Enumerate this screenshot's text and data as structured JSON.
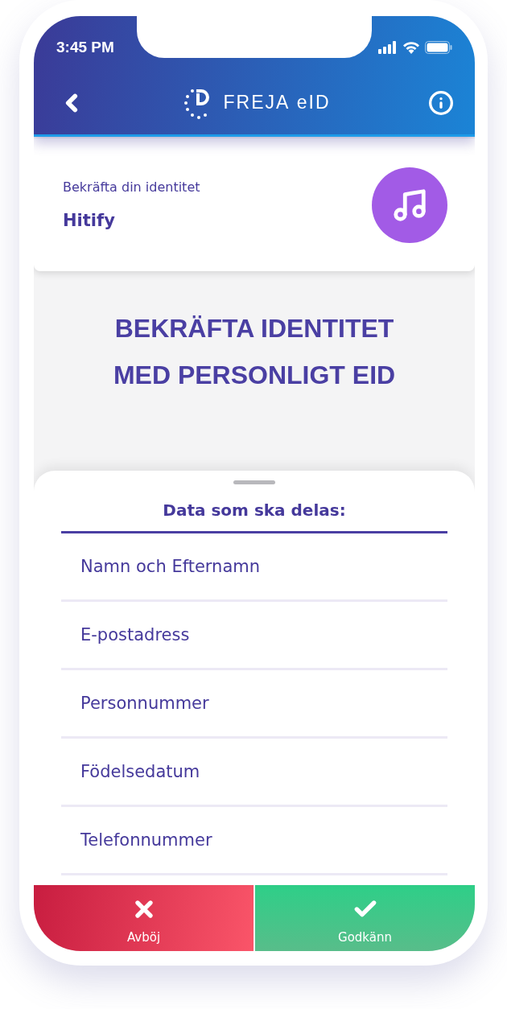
{
  "status_bar": {
    "time": "3:45 PM"
  },
  "header": {
    "brand": "**FREJA** eID"
  },
  "request_card": {
    "caption": "Bekräfta din identitet",
    "service": "Hitify"
  },
  "heading": "BEKRÄFTA IDENTITET MED PERSONLIGT EID",
  "sheet": {
    "title": "Data som ska delas:",
    "items": [
      {
        "label": "Namn och Efternamn"
      },
      {
        "label": "E-postadress"
      },
      {
        "label": "Personnummer"
      },
      {
        "label": "Födelsedatum"
      },
      {
        "label": "Telefonnummer"
      }
    ]
  },
  "actions": [
    {
      "kind": "decline",
      "label": "Avböj"
    },
    {
      "kind": "approve",
      "label": "Godkänn"
    }
  ]
}
